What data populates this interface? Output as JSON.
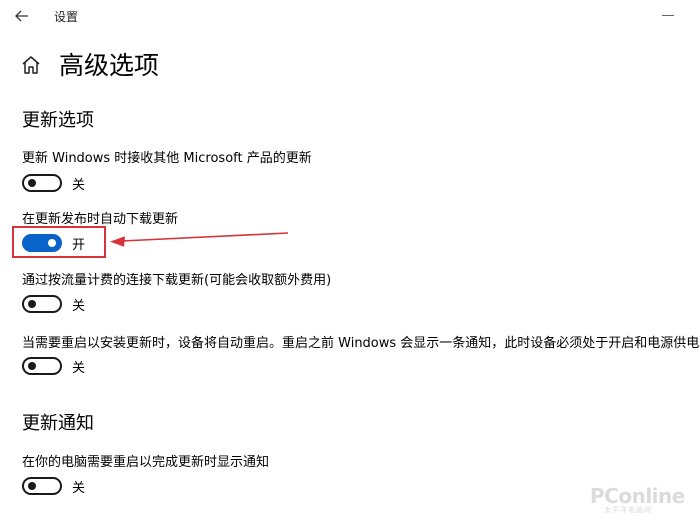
{
  "window": {
    "title": "设置"
  },
  "page": {
    "title": "高级选项"
  },
  "sections": {
    "update_options": {
      "title": "更新选项",
      "settings": [
        {
          "label": "更新 Windows 时接收其他 Microsoft 产品的更新",
          "state": "关",
          "on": false
        },
        {
          "label": "在更新发布时自动下载更新",
          "state": "开",
          "on": true
        },
        {
          "label": "通过按流量计费的连接下载更新(可能会收取额外费用)",
          "state": "关",
          "on": false
        },
        {
          "label": "当需要重启以安装更新时，设备将自动重启。重启之前 Windows 会显示一条通知，此时设备必须处于开启和电源供电",
          "state": "关",
          "on": false
        }
      ]
    },
    "update_notifications": {
      "title": "更新通知",
      "settings": [
        {
          "label": "在你的电脑需要重启以完成更新时显示通知",
          "state": "关",
          "on": false
        }
      ]
    }
  },
  "annotation": {
    "box_color": "#d6333a",
    "arrow_color": "#d6333a"
  },
  "colors": {
    "toggle_on": "#0a63c9",
    "toggle_off": "#1a1a1a"
  },
  "watermark": {
    "text": "PConline",
    "subtext": "太平洋电脑网"
  }
}
